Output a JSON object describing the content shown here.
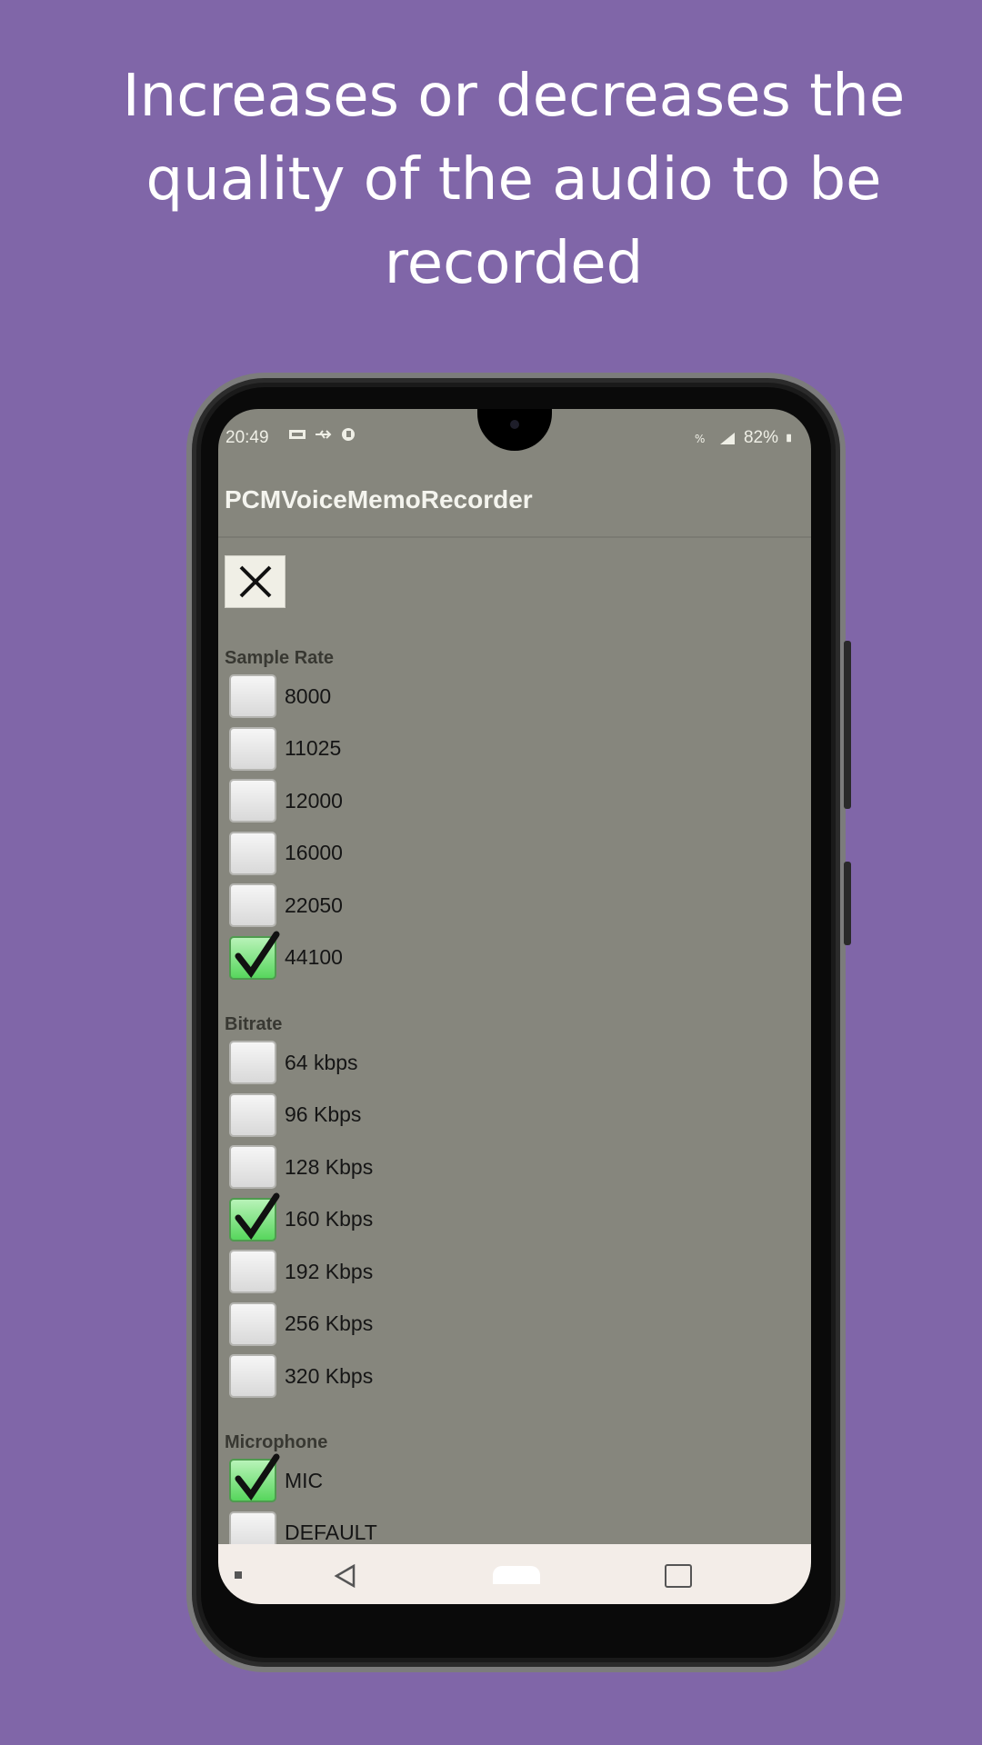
{
  "headline": {
    "line1": "Increases or decreases the",
    "line2": "quality  of  the audio to be",
    "line3": "recorded"
  },
  "status": {
    "time": "20:49",
    "battery": "82%"
  },
  "app": {
    "title": "PCMVoiceMemoRecorder"
  },
  "close_icon": "close-icon",
  "sample_rate": {
    "label": "Sample Rate",
    "options": [
      {
        "label": "8000",
        "checked": false
      },
      {
        "label": "11025",
        "checked": false
      },
      {
        "label": "12000",
        "checked": false
      },
      {
        "label": "16000",
        "checked": false
      },
      {
        "label": "22050",
        "checked": false
      },
      {
        "label": "44100",
        "checked": true
      }
    ]
  },
  "bitrate": {
    "label": "Bitrate",
    "options": [
      {
        "label": "64 kbps",
        "checked": false
      },
      {
        "label": "96 Kbps",
        "checked": false
      },
      {
        "label": "128 Kbps",
        "checked": false
      },
      {
        "label": "160 Kbps",
        "checked": true
      },
      {
        "label": "192 Kbps",
        "checked": false
      },
      {
        "label": "256 Kbps",
        "checked": false
      },
      {
        "label": "320 Kbps",
        "checked": false
      }
    ]
  },
  "microphone": {
    "label": "Microphone",
    "options": [
      {
        "label": "MIC",
        "checked": true
      },
      {
        "label": "DEFAULT",
        "checked": false
      }
    ]
  },
  "colors": {
    "background": "#8066a8",
    "screen": "#86867d",
    "checked": "#57d65d"
  }
}
